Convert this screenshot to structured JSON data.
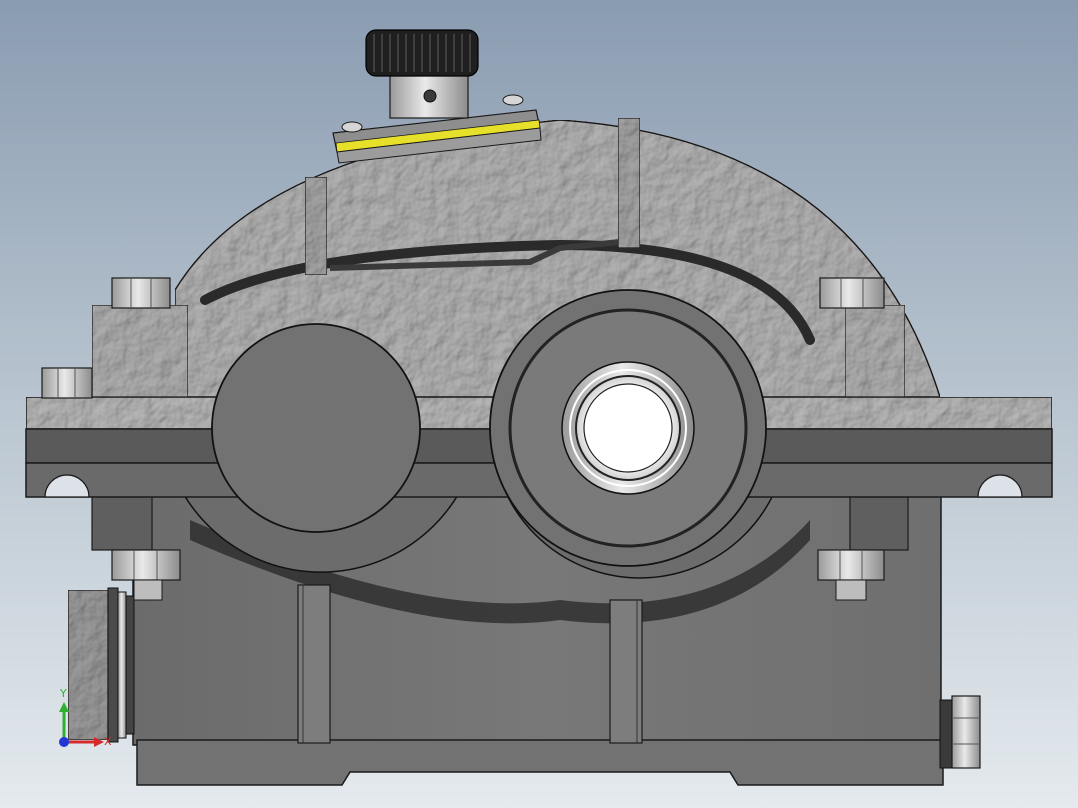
{
  "viewport": {
    "background_top": "#8a9cb1",
    "background_bottom": "#e4eaee"
  },
  "model": {
    "cast_iron_color": "#b8b8b8",
    "machined_color": "#6e6e6e",
    "gasket_color": "#e6e02a",
    "knob_color": "#1f1f1f"
  },
  "triad": {
    "y_label": "Y",
    "x_label": "X",
    "y_color": "#2fb12f",
    "x_color": "#d42a2a",
    "z_color": "#2236d6"
  }
}
